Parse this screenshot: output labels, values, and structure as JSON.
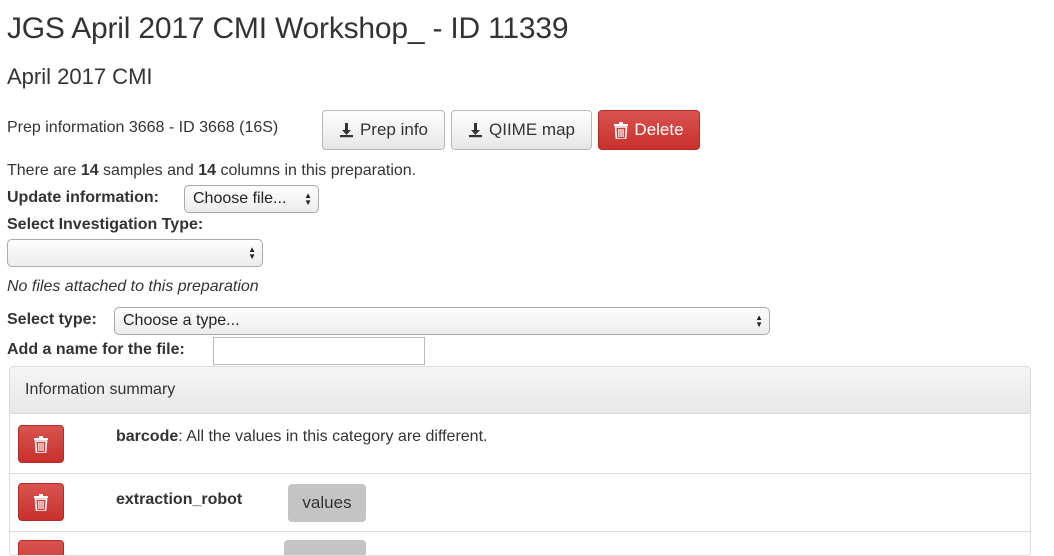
{
  "page": {
    "title": "JGS April 2017 CMI Workshop_ - ID 11339",
    "subtitle": "April 2017 CMI"
  },
  "prep": {
    "label": "Prep information 3668 - ID 3668 (16S)",
    "prep_info_button": "Prep info",
    "qiime_map_button": "QIIME map",
    "delete_button": "Delete"
  },
  "summary_line": {
    "prefix": "There are ",
    "samples": "14",
    "middle": " samples and ",
    "columns": "14",
    "suffix": " columns in this preparation."
  },
  "update": {
    "label": "Update information:",
    "file_select": "Choose file..."
  },
  "investigation": {
    "label": "Select Investigation Type:",
    "value": ""
  },
  "no_files_note": "No files attached to this preparation",
  "select_type": {
    "label": "Select type:",
    "value": "Choose a type..."
  },
  "file_name": {
    "label": "Add a name for the file:",
    "value": ""
  },
  "info_summary": {
    "heading": "Information summary",
    "rows": [
      {
        "name": "barcode",
        "description": ": All the values in this category are different."
      },
      {
        "name": "extraction_robot",
        "values_button": "values"
      }
    ]
  },
  "colors": {
    "danger": "#d9534f",
    "default_button": "#e6e6e6",
    "values_button": "#c4c4c4"
  }
}
